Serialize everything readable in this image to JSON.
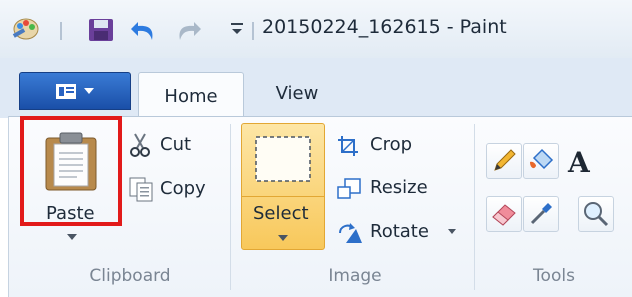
{
  "window": {
    "title": "20150224_162615 - Paint"
  },
  "quick_access": {
    "icons": [
      "paint-app-icon",
      "save-icon",
      "undo-icon",
      "redo-icon",
      "customize-dropdown-icon"
    ]
  },
  "tabs": [
    {
      "label": "Home",
      "selected": true
    },
    {
      "label": "View",
      "selected": false
    }
  ],
  "ribbon": {
    "clipboard": {
      "label": "Clipboard",
      "paste_label": "Paste",
      "cut_label": "Cut",
      "copy_label": "Copy"
    },
    "image": {
      "label": "Image",
      "select_label": "Select",
      "crop_label": "Crop",
      "resize_label": "Resize",
      "rotate_label": "Rotate"
    },
    "tools": {
      "label": "Tools",
      "items": [
        "pencil-icon",
        "fill-icon",
        "text-icon",
        "eraser-icon",
        "color-picker-icon",
        "magnifier-icon"
      ]
    }
  },
  "colors": {
    "accent_blue": "#1a4fa8",
    "highlight_red": "#e21a1a",
    "select_orange": "#f8c85b"
  }
}
